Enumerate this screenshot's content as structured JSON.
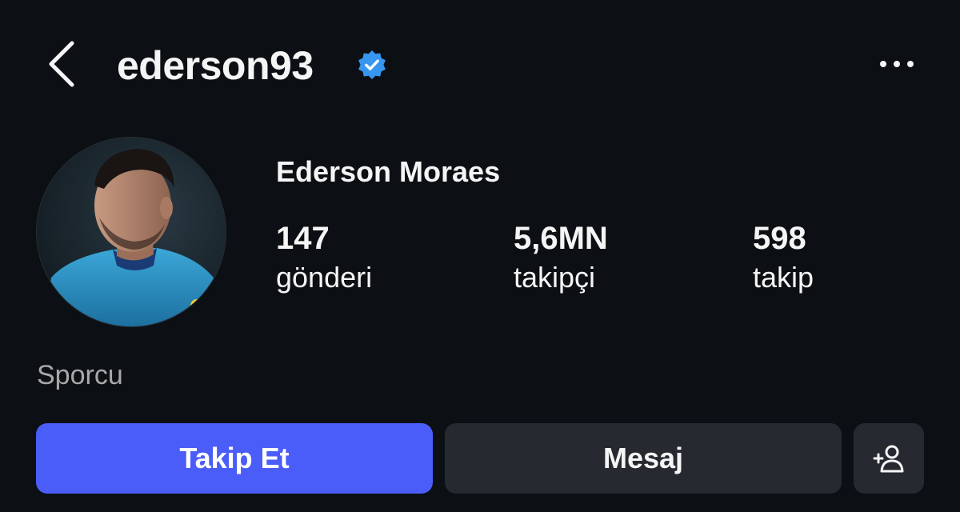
{
  "header": {
    "username": "ederson93",
    "verified": true,
    "back_icon": "chevron-left-icon",
    "more_icon": "more-horizontal-icon"
  },
  "profile": {
    "full_name": "Ederson Moraes",
    "category": "Sporcu",
    "stats": [
      {
        "value": "147",
        "label": "gönderi"
      },
      {
        "value": "5,6MN",
        "label": "takipçi"
      },
      {
        "value": "598",
        "label": "takip"
      }
    ]
  },
  "actions": {
    "follow_label": "Takip Et",
    "message_label": "Mesaj",
    "suggest_icon": "add-person-icon"
  },
  "colors": {
    "background": "#0c1014",
    "primary_button": "#4a5df9",
    "secondary_button": "#262a30",
    "verified_badge": "#3797f0",
    "muted_text": "#a8a8a8"
  }
}
